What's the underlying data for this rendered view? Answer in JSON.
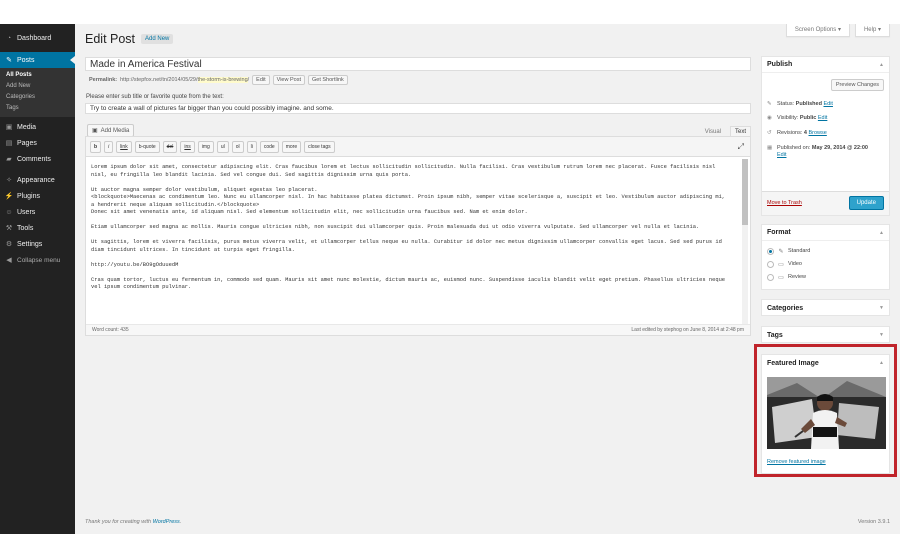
{
  "sidebar": {
    "items": [
      {
        "icon": "dashboard-icon",
        "glyph": "◔",
        "label": "Dashboard"
      },
      {
        "icon": "pushpin-icon",
        "glyph": "✎",
        "label": "Posts"
      },
      {
        "icon": "media-icon",
        "glyph": "▣",
        "label": "Media"
      },
      {
        "icon": "pages-icon",
        "glyph": "▤",
        "label": "Pages"
      },
      {
        "icon": "comments-icon",
        "glyph": "▰",
        "label": "Comments"
      },
      {
        "icon": "appearance-icon",
        "glyph": "✧",
        "label": "Appearance"
      },
      {
        "icon": "plugins-icon",
        "glyph": "⚡",
        "label": "Plugins"
      },
      {
        "icon": "users-icon",
        "glyph": "☺",
        "label": "Users"
      },
      {
        "icon": "tools-icon",
        "glyph": "⚒",
        "label": "Tools"
      },
      {
        "icon": "settings-icon",
        "glyph": "⚙",
        "label": "Settings"
      },
      {
        "icon": "collapse-icon",
        "glyph": "◀",
        "label": "Collapse menu"
      }
    ],
    "posts_sub": [
      "All Posts",
      "Add New",
      "Categories",
      "Tags"
    ]
  },
  "top": {
    "screen_options": "Screen Options",
    "help": "Help"
  },
  "header": {
    "title": "Edit Post",
    "add_new": "Add New"
  },
  "post": {
    "title": "Made in America Festival",
    "permalink_label": "Permalink:",
    "permalink_base": "http://stepfox.net/tn/2014/05/29/",
    "permalink_slug": "the-storm-is-brewing",
    "permalink_tail": "/",
    "edit_btn": "Edit",
    "view_post_btn": "View Post",
    "shortlink_btn": "Get Shortlink",
    "subtitle_label": "Please enter sub title or favorite quote from the text:",
    "subtitle_value": "Try to create a wall of pictures far bigger than you could possibly imagine. and some."
  },
  "editor": {
    "add_media": "Add Media",
    "tab_visual": "Visual",
    "tab_text": "Text",
    "quicktags": [
      "b",
      "i",
      "link",
      "b-quote",
      "del",
      "ins",
      "img",
      "ul",
      "ol",
      "li",
      "code",
      "more",
      "close tags"
    ],
    "content": [
      "Lorem ipsum dolor sit amet, consectetur adipiscing elit. Cras faucibus lorem et lectus sollicitudin sollicitudin. Nulla facilisi. Cras vestibulum rutrum lorem nec placerat. Fusce facilisis nisl nisl, eu fringilla leo blandit lacinia. Sed vel congue dui. Sed sagittis dignissim urna quis porta.",
      "Ut auctor magna semper dolor vestibulum, aliquet egestas leo placerat.\n<blockquote>Maecenas ac condimentum leo. Nunc eu ullamcorper nisl. In hac habitasse platea dictumst. Proin ipsum nibh, semper vitae scelerisque a, suscipit et leo. Vestibulum auctor adipiscing mi, a hendrerit neque aliquam sollicitudin.</blockquote>\nDonec sit amet venenatis ante, id aliquam nisl. Sed elementum sollicitudin elit, nec sollicitudin urna faucibus sed. Nam et enim dolor.",
      "Etiam ullamcorper sed magna ac mollis. Mauris congue ultricies nibh, non suscipit dui ullamcorper quis. Proin malesuada dui ut odio viverra vulputate. Sed ullamcorper vel nulla et lacinia.",
      "Ut sagittis, lorem et viverra facilisis, purus metus viverra velit, et ullamcorper tellus neque eu nulla. Curabitur id dolor nec metus dignissim ullamcorper convallis eget lacus. Sed sed purus id diam tincidunt ultrices. In tincidunt at turpis eget fringilla.",
      "http://youtu.be/BO9gOduuedM",
      "Cras quam tortor, luctus eu fermentum in, commodo sed quam. Mauris sit amet nunc molestie, dictum mauris ac, euismod nunc. Suspendisse iaculis blandit velit eget pretium. Phasellus ultricies neque vel ipsum condimentum pulvinar."
    ],
    "word_count": "Word count: 435",
    "last_edited": "Last edited by stephog on June 8, 2014 at 2:48 pm"
  },
  "footer": {
    "thanks_prefix": "Thank you for creating with ",
    "wordpress": "WordPress",
    "thanks_suffix": ".",
    "version": "Version 3.9.1"
  },
  "publish": {
    "title": "Publish",
    "preview": "Preview Changes",
    "status_label": "Status: ",
    "status_value": "Published",
    "edit": "Edit",
    "visibility_label": "Visibility: ",
    "visibility_value": "Public",
    "revisions_label": "Revisions: ",
    "revisions_value": "4",
    "browse": "Browse",
    "published_label": "Published on: ",
    "published_value": "May 29, 2014 @ 22:00",
    "trash": "Move to Trash",
    "update": "Update"
  },
  "format": {
    "title": "Format",
    "options": [
      {
        "label": "Standard",
        "selected": true,
        "icon": "pushpin-icon"
      },
      {
        "label": "Video",
        "selected": false,
        "icon": "video-icon"
      },
      {
        "label": "Review",
        "selected": false,
        "icon": "review-icon"
      }
    ]
  },
  "categories": {
    "title": "Categories"
  },
  "tags": {
    "title": "Tags"
  },
  "featured": {
    "title": "Featured Image",
    "remove": "Remove featured image"
  },
  "colors": {
    "accent": "#0074a2",
    "highlight": "#c0242b",
    "update": "#2ea2cc"
  }
}
